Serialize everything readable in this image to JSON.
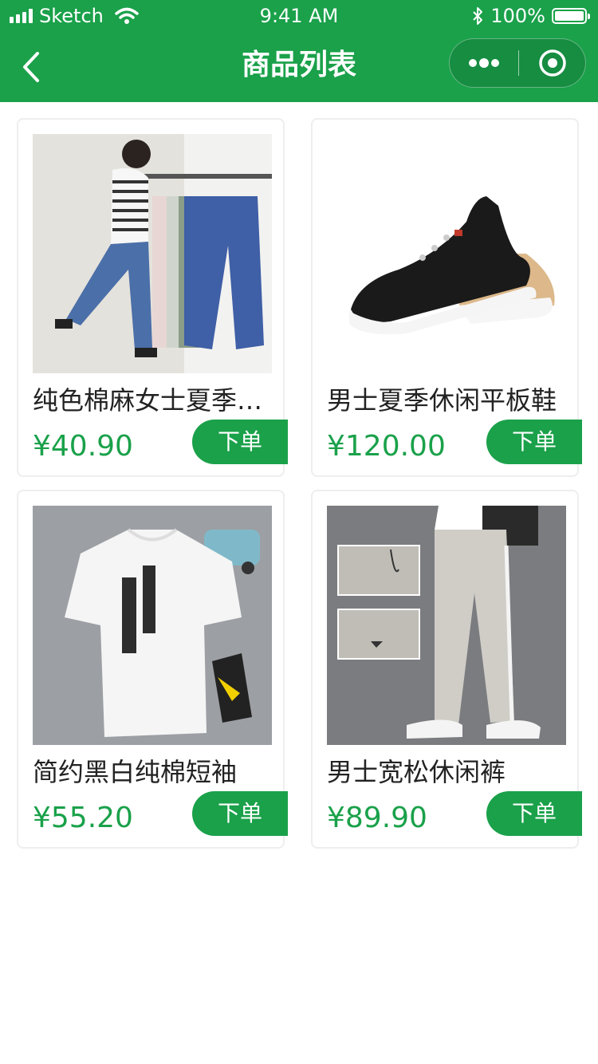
{
  "status_bar": {
    "carrier": "Sketch",
    "time": "9:41 AM",
    "battery": "100%"
  },
  "nav": {
    "title": "商品列表"
  },
  "products": [
    {
      "name": "纯色棉麻女士夏季休闲裤",
      "price": "¥40.90",
      "button": "下单"
    },
    {
      "name": "男士夏季休闲平板鞋",
      "price": "¥120.00",
      "button": "下单"
    },
    {
      "name": "简约黑白纯棉短袖",
      "price": "¥55.20",
      "button": "下单"
    },
    {
      "name": "男士宽松休闲裤",
      "price": "¥89.90",
      "button": "下单"
    }
  ],
  "colors": {
    "primary": "#1aa14a",
    "card_border": "#eeeeee"
  },
  "icons": [
    "signal-icon",
    "wifi-icon",
    "bluetooth-icon",
    "battery-icon",
    "back-icon",
    "more-icon",
    "close-circle-icon"
  ]
}
